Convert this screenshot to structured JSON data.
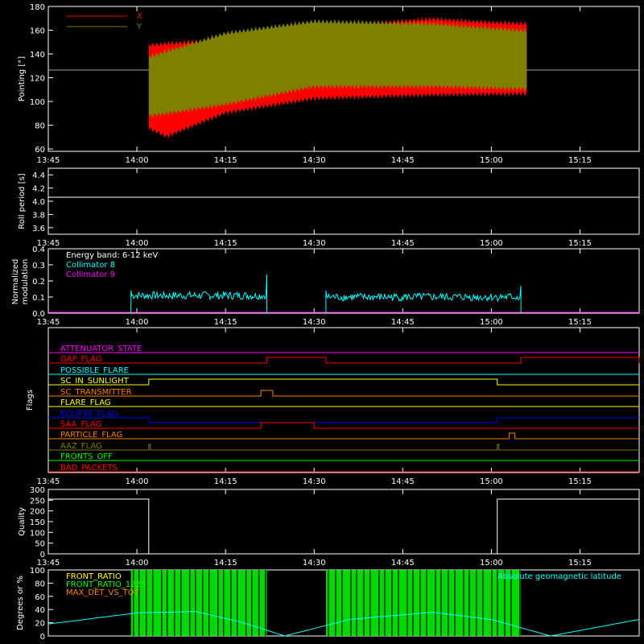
{
  "x_ticks": [
    "13:45",
    "14:00",
    "14:15",
    "14:30",
    "14:45",
    "15:00",
    "15:15"
  ],
  "chart_data": [
    {
      "type": "line",
      "ylabel": "Pointing [°]",
      "ylim": [
        58,
        180
      ],
      "yticks": [
        "60",
        "80",
        "100",
        "120",
        "140",
        "160",
        "180"
      ],
      "series": [
        {
          "name": "X",
          "color": "#ff0000",
          "envelope_top": [
            [
              14.033,
              150
            ],
            [
              14.167,
              153
            ],
            [
              14.5,
              165
            ],
            [
              14.833,
              172
            ],
            [
              15.0,
              169
            ],
            [
              15.1,
              168
            ]
          ],
          "envelope_bottom": [
            [
              14.033,
              75
            ],
            [
              14.083,
              68
            ],
            [
              14.25,
              88
            ],
            [
              14.5,
              100
            ],
            [
              14.833,
              103
            ],
            [
              15.1,
              104
            ]
          ]
        },
        {
          "name": "Y",
          "color": "#808000",
          "envelope_top": [
            [
              14.033,
              140
            ],
            [
              14.25,
              160
            ],
            [
              14.5,
              170
            ],
            [
              14.833,
              168
            ],
            [
              15.1,
              162
            ]
          ],
          "envelope_bottom": [
            [
              14.033,
              85
            ],
            [
              14.25,
              95
            ],
            [
              14.5,
              110
            ],
            [
              14.833,
              110
            ],
            [
              15.1,
              108
            ]
          ]
        }
      ],
      "reference_line": 128,
      "x_range": [
        "14:02",
        "15:06"
      ]
    },
    {
      "type": "line",
      "ylabel": "Roll period [s]",
      "ylim": [
        3.5,
        4.5
      ],
      "yticks": [
        "3.6",
        "3.8",
        "4.0",
        "4.2",
        "4.4"
      ],
      "series": [
        {
          "name": "",
          "color": "#ffffff",
          "values_constant": 4.0
        }
      ]
    },
    {
      "type": "line",
      "ylabel": "Normalized modulation",
      "ylim": [
        0,
        0.4
      ],
      "yticks": [
        "0.0",
        "0.1",
        "0.2",
        "0.3",
        "0.4"
      ],
      "annotation": "Energy band: 6-12 keV",
      "series": [
        {
          "name": "Collimator 8",
          "color": "#00ffff",
          "segments": [
            [
              "13:59",
              "14:22",
              0.11
            ],
            [
              "14:32",
              "15:05",
              0.1
            ]
          ]
        },
        {
          "name": "Collimator 9",
          "color": "#ff00ff",
          "values_constant": 0.0
        }
      ]
    },
    {
      "type": "line",
      "ylabel": "Flags",
      "series": [
        {
          "name": "ATTENUATOR_STATE",
          "color": "#ff00ff"
        },
        {
          "name": "GAP_FLAG",
          "color": "#ff0000"
        },
        {
          "name": "POSSIBLE_FLARE",
          "color": "#00ffff"
        },
        {
          "name": "SC_IN_SUNLIGHT",
          "color": "#ffff00"
        },
        {
          "name": "SC_TRANSMITTER",
          "color": "#ff8000"
        },
        {
          "name": "FLARE_FLAG",
          "color": "#ffff00"
        },
        {
          "name": "ECLIPSE_FLAG",
          "color": "#0000ff"
        },
        {
          "name": "SAA_FLAG",
          "color": "#ff0000"
        },
        {
          "name": "PARTICLE_FLAG",
          "color": "#ff8000"
        },
        {
          "name": "AAZ_FLAG",
          "color": "#808000"
        },
        {
          "name": "FRONTS_OFF",
          "color": "#00ff00"
        },
        {
          "name": "BAD_PACKETS",
          "color": "#ff0000"
        }
      ]
    },
    {
      "type": "line",
      "ylabel": "Quality",
      "ylim": [
        0,
        300
      ],
      "yticks": [
        "0",
        "50",
        "100",
        "150",
        "200",
        "250",
        "300"
      ],
      "series": [
        {
          "name": "",
          "color": "#ffffff",
          "segments": [
            [
              "13:45",
              "14:02",
              255
            ],
            [
              "14:02",
              "15:01",
              0
            ],
            [
              "15:01",
              "15:25",
              255
            ]
          ]
        }
      ]
    },
    {
      "type": "line",
      "ylabel": "Degrees or %",
      "ylim": [
        0,
        100
      ],
      "yticks": [
        "0",
        "20",
        "40",
        "60",
        "80",
        "100"
      ],
      "series": [
        {
          "name": "FRONT_RATIO",
          "color": "#ffff00"
        },
        {
          "name": "FRONT_RATIO_1225",
          "color": "#00ff00"
        },
        {
          "name": "MAX_DET_VS_TOT",
          "color": "#ff8000"
        },
        {
          "name": "Absolute geomagnetic latitude",
          "color": "#00ffff"
        }
      ]
    }
  ]
}
